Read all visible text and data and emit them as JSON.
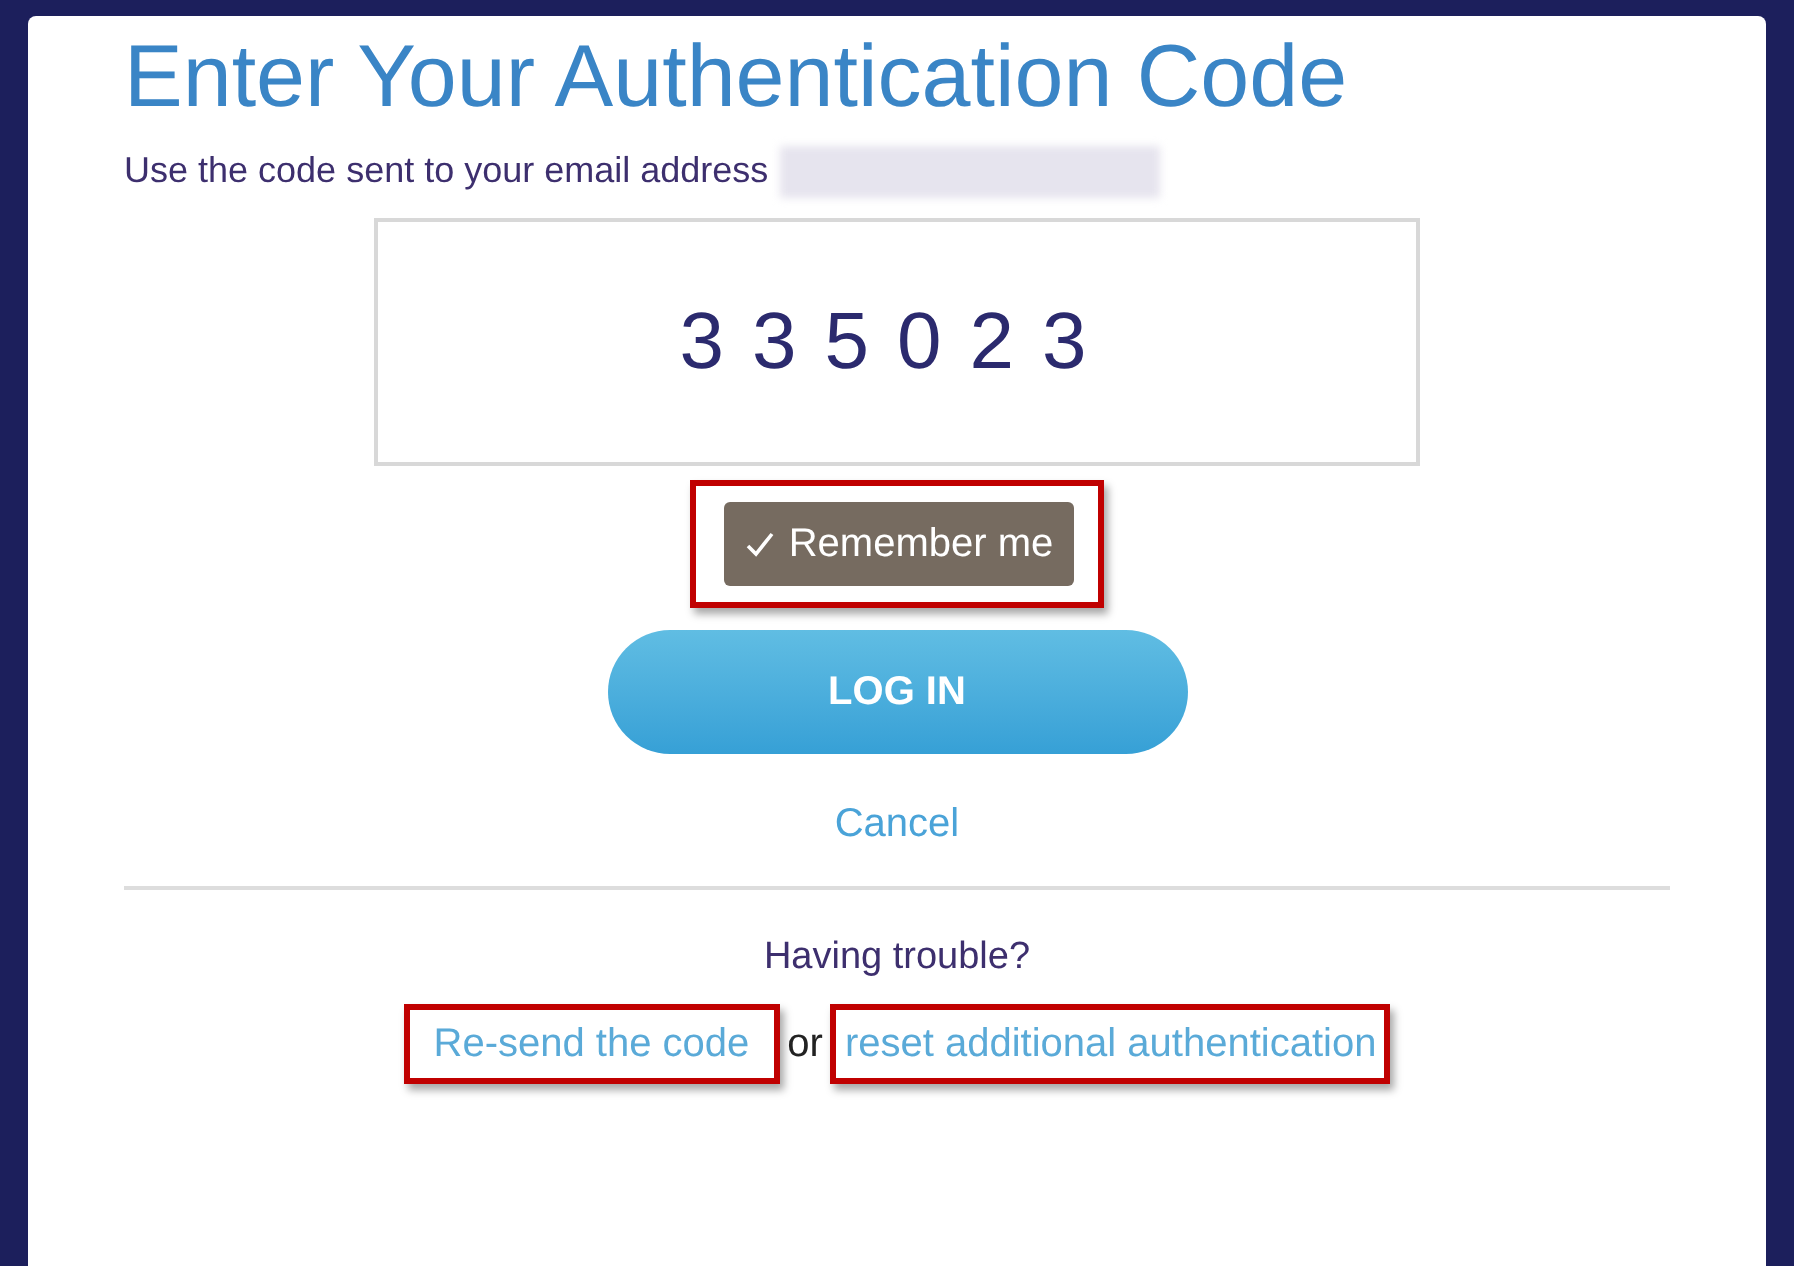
{
  "title": "Enter Your Authentication Code",
  "instruction": "Use the code sent to your email address",
  "code_field": {
    "value": "335023"
  },
  "remember_me": {
    "label": "Remember me",
    "checked": true
  },
  "login_button": "LOG IN",
  "cancel_link": "Cancel",
  "trouble": {
    "heading": "Having trouble?",
    "resend_link": "Re-send the code",
    "separator": "or",
    "reset_link": "reset additional authentication"
  }
}
